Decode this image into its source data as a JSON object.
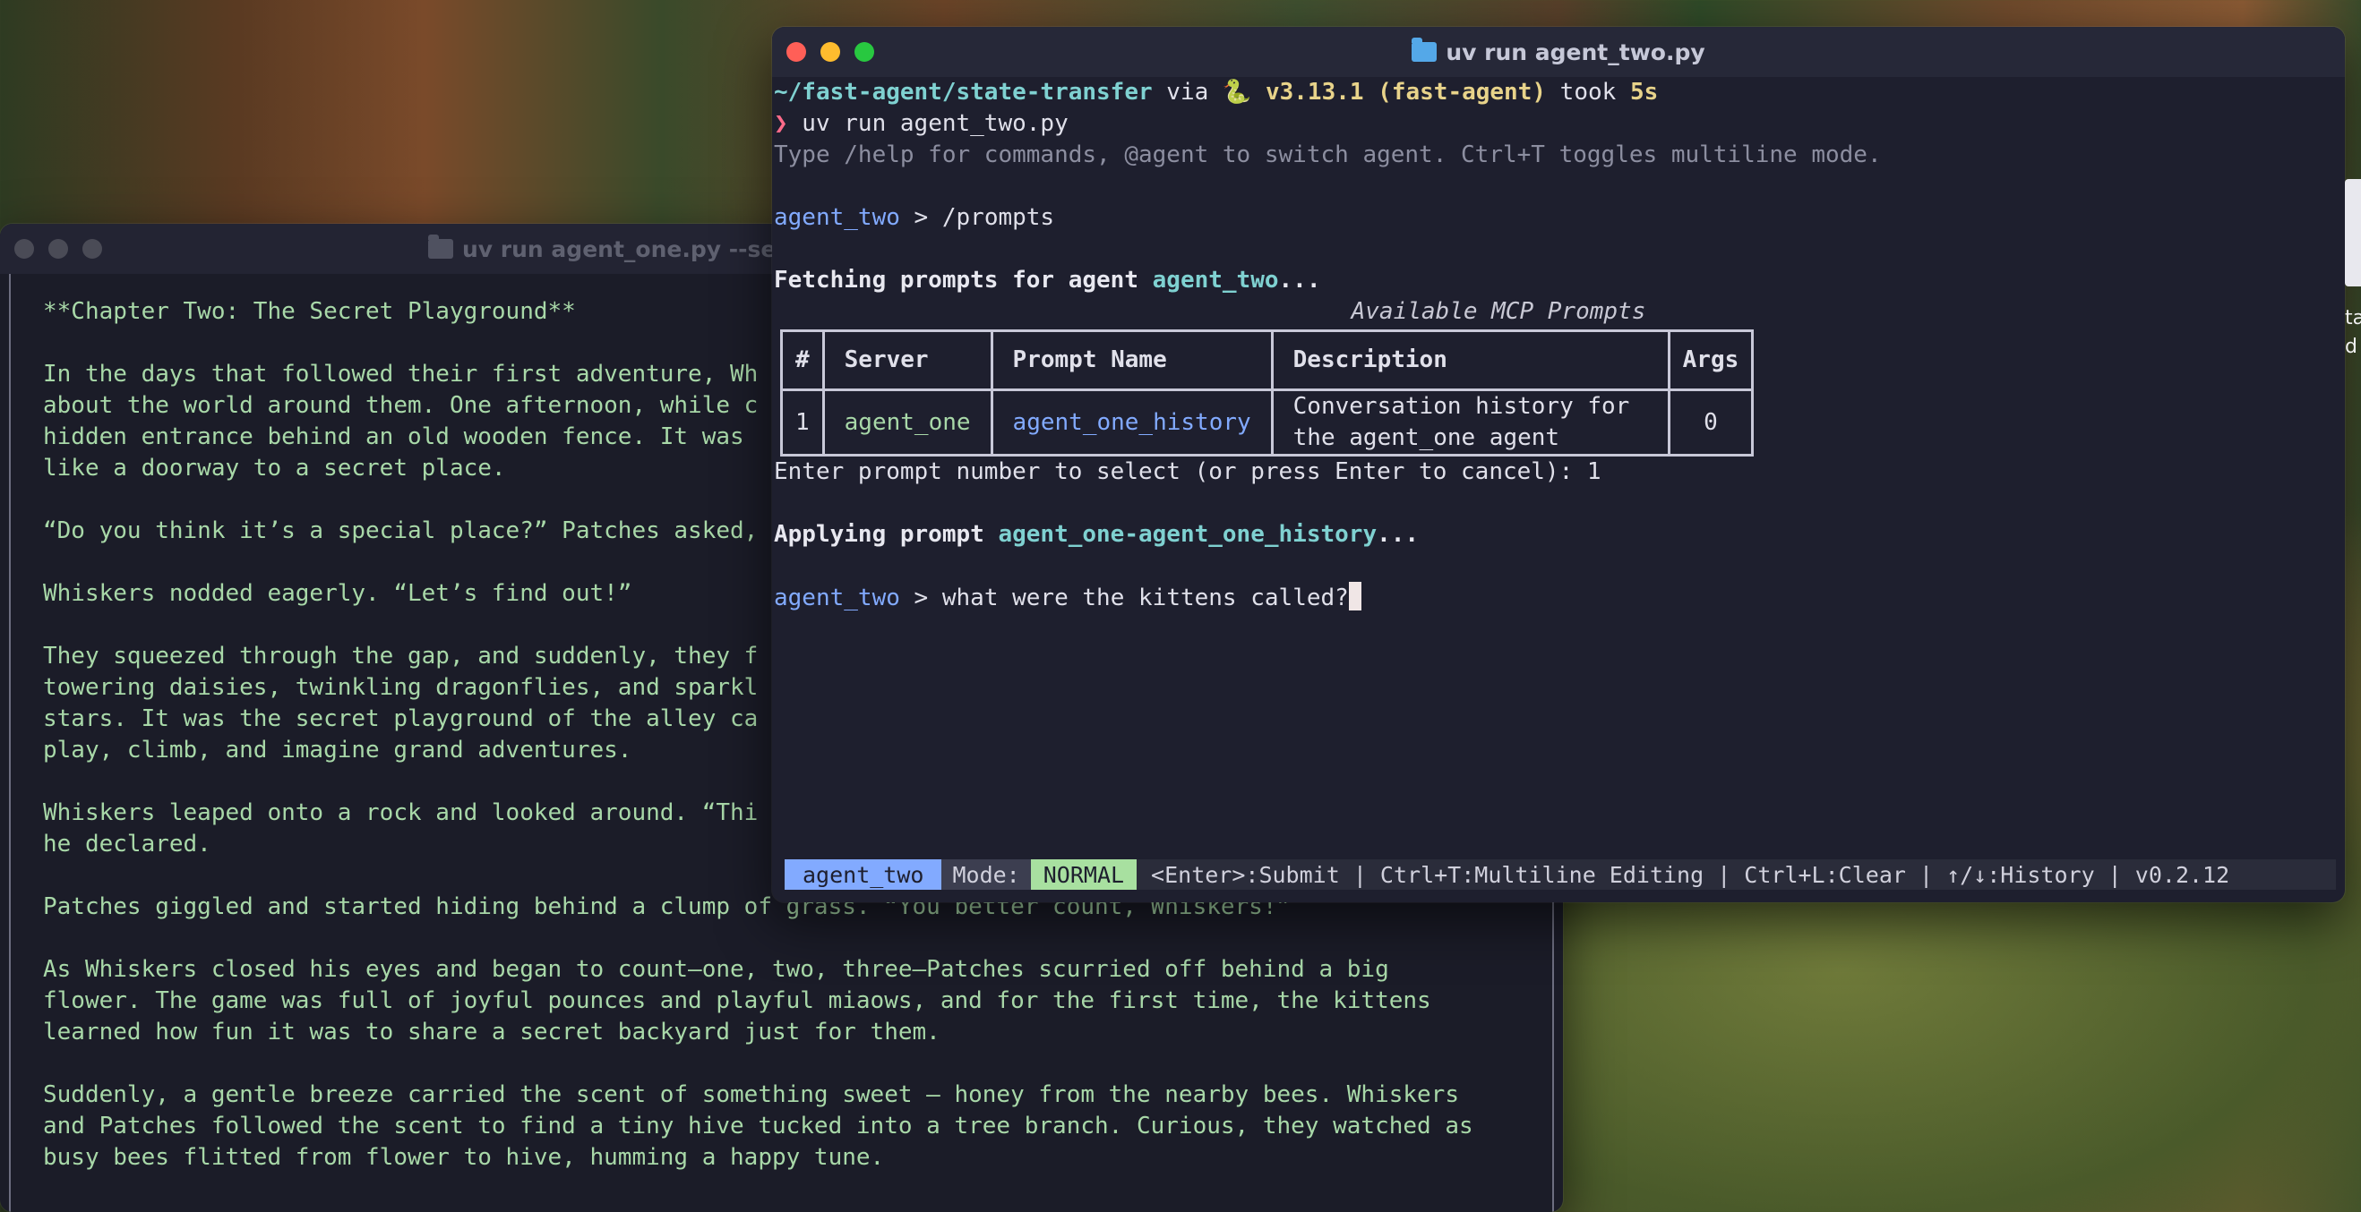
{
  "desktop": {
    "edge_text": [
      "ta",
      "d"
    ]
  },
  "window_one": {
    "title": "uv run agent_one.py --ser",
    "story": [
      "**Chapter Two: The Secret Playground**",
      "In the days that followed their first adventure, Wh\nabout the world around them. One afternoon, while c\nhidden entrance behind an old wooden fence. It was \nlike a doorway to a secret place.",
      "“Do you think it’s a special place?” Patches asked,",
      "Whiskers nodded eagerly. “Let’s find out!”",
      "They squeezed through the gap, and suddenly, they f\ntowering daisies, twinkling dragonflies, and sparkl\nstars. It was the secret playground of the alley ca\nplay, climb, and imagine grand adventures.",
      "Whiskers leaped onto a rock and looked around. “Thi\nhe declared.",
      "Patches giggled and started hiding behind a clump of grass. “You better count, Whiskers!”",
      "As Whiskers closed his eyes and began to count—one, two, three—Patches scurried off behind a big\nflower. The game was full of joyful pounces and playful miaows, and for the first time, the kittens\nlearned how fun it was to share a secret backyard just for them.",
      "Suddenly, a gentle breeze carried the scent of something sweet — honey from the nearby bees. Whiskers\nand Patches followed the scent to find a tiny hive tucked into a tree branch. Curious, they watched as\nbusy bees flitted from flower to hive, humming a happy tune."
    ]
  },
  "window_two": {
    "title": "uv run agent_two.py",
    "prompt_line": {
      "path": "~/fast-agent/state-transfer",
      "via": " via ",
      "snake": "🐍",
      "version": " v3.13.1 (fast-agent)",
      "took": " took ",
      "duration": "5s"
    },
    "command_line": {
      "chevron": "❯",
      "command": " uv run agent_two.py"
    },
    "help_line": "Type /help for commands, @agent to switch agent. Ctrl+T toggles multiline mode.",
    "input1": {
      "agent": "agent_two",
      "sep": " > ",
      "text": "/prompts"
    },
    "fetching": {
      "prefix": "Fetching prompts for agent ",
      "agent": "agent_two",
      "suffix": "..."
    },
    "table_title": "Available MCP Prompts",
    "table": {
      "headers": [
        "#",
        "Server",
        "Prompt Name",
        "Description",
        "Args"
      ],
      "rows": [
        {
          "num": "1",
          "server": "agent_one",
          "prompt": "agent_one_history",
          "description": "Conversation history for the agent_one agent",
          "args": "0"
        }
      ]
    },
    "select_line": "Enter prompt number to select (or press Enter to cancel): 1",
    "applying": {
      "prefix": "Applying prompt ",
      "name": "agent_one-agent_one_history",
      "suffix": "..."
    },
    "input2": {
      "agent": "agent_two",
      "sep": " > ",
      "text": "what were the kittens called?"
    },
    "statusbar": {
      "agent": "agent_two",
      "mode_label": "Mode:",
      "mode": "NORMAL",
      "hints": "<Enter>:Submit | Ctrl+T:Multiline Editing | Ctrl+L:Clear | ↑/↓:History | v0.2.12"
    }
  },
  "colors": {
    "close": "#ff5f57",
    "minimize": "#febc2e",
    "zoom": "#28c840",
    "accent": "#82aaff"
  }
}
